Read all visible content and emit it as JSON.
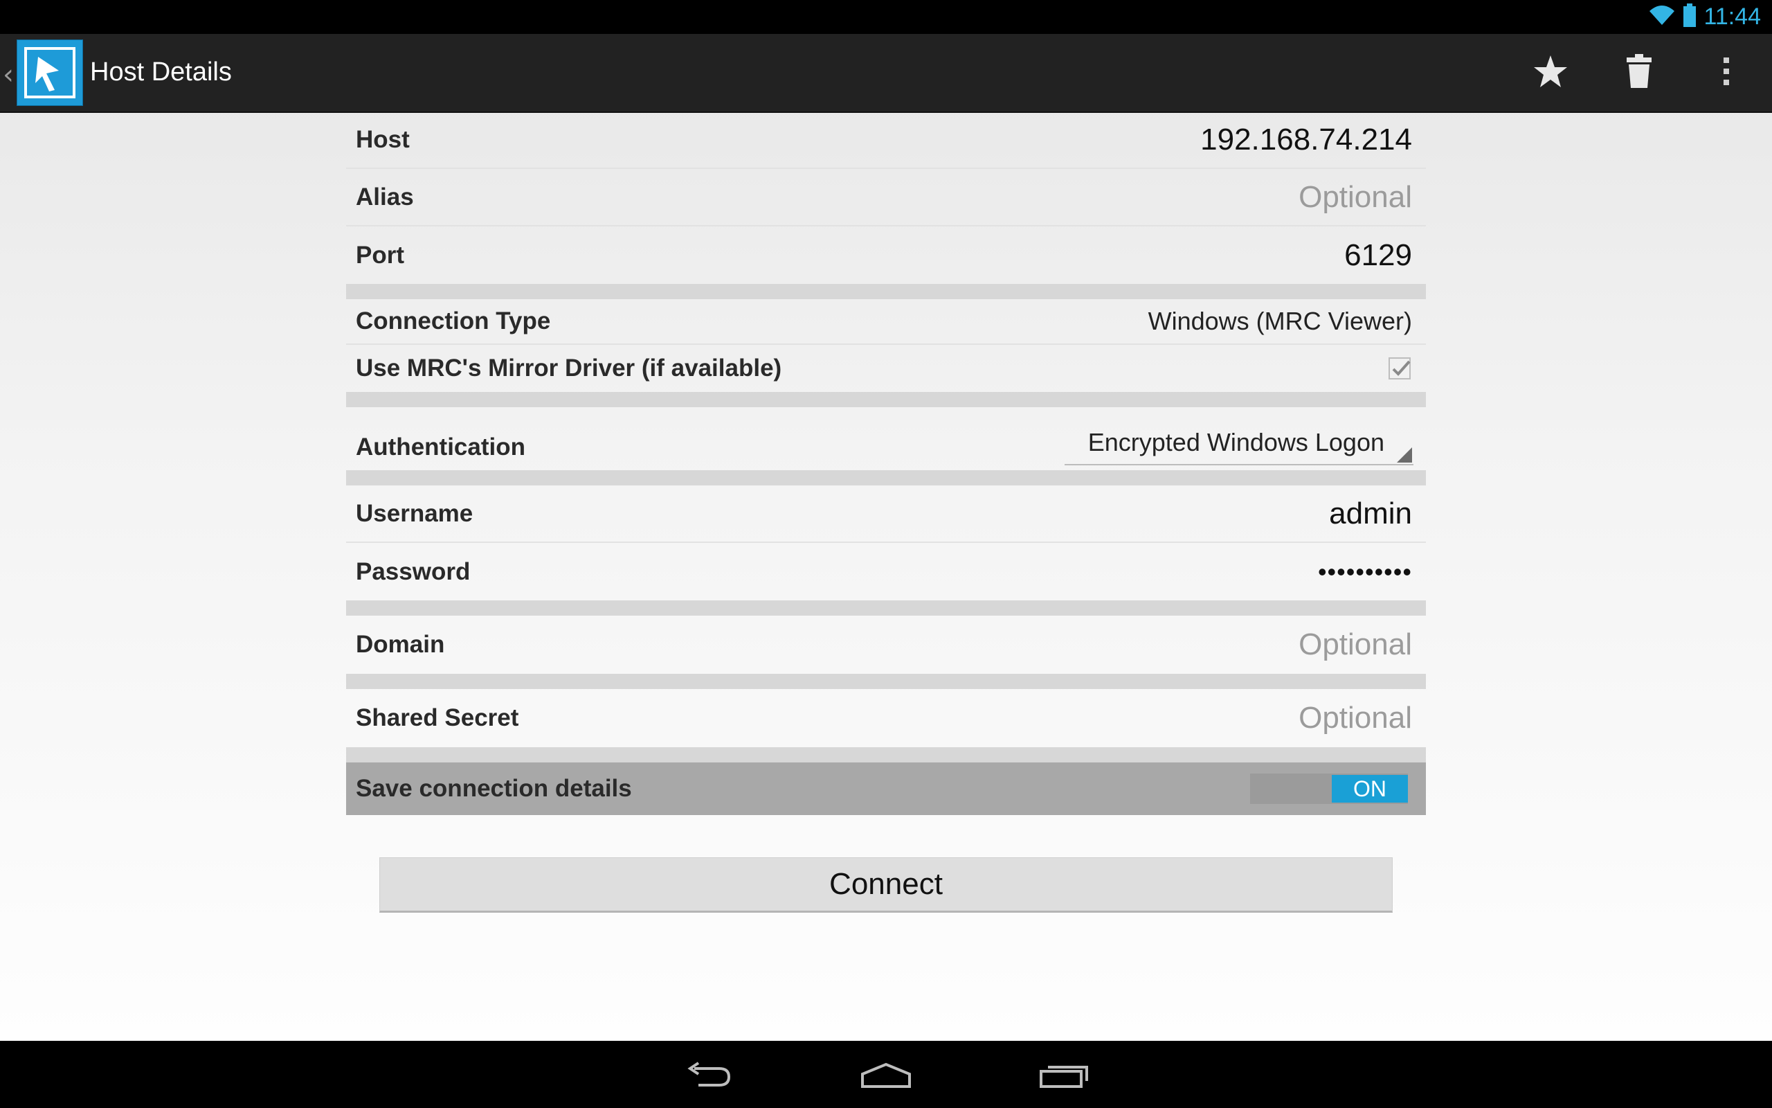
{
  "status_bar": {
    "time": "11:44"
  },
  "action_bar": {
    "title": "Host Details",
    "actions": [
      "star-icon",
      "trash-icon",
      "overflow-menu-icon"
    ]
  },
  "form": {
    "host": {
      "label": "Host",
      "value": "192.168.74.214"
    },
    "alias": {
      "label": "Alias",
      "placeholder": "Optional"
    },
    "port": {
      "label": "Port",
      "value": "6129"
    },
    "connection_type": {
      "label": "Connection Type",
      "value": "Windows (MRC Viewer)"
    },
    "mirror_driver": {
      "label": "Use MRC's Mirror Driver (if available)",
      "checked": true
    },
    "authentication": {
      "label": "Authentication",
      "value": "Encrypted Windows Logon"
    },
    "username": {
      "label": "Username",
      "value": "admin"
    },
    "password": {
      "label": "Password",
      "value": "••••••••••"
    },
    "domain": {
      "label": "Domain",
      "placeholder": "Optional"
    },
    "shared_secret": {
      "label": "Shared Secret",
      "placeholder": "Optional"
    },
    "save_details": {
      "label": "Save connection details",
      "toggle": "ON"
    }
  },
  "connect_button": {
    "label": "Connect"
  },
  "colors": {
    "accent": "#33b5e5",
    "toggle_on": "#1aa0d6",
    "action_bar": "#222222"
  }
}
